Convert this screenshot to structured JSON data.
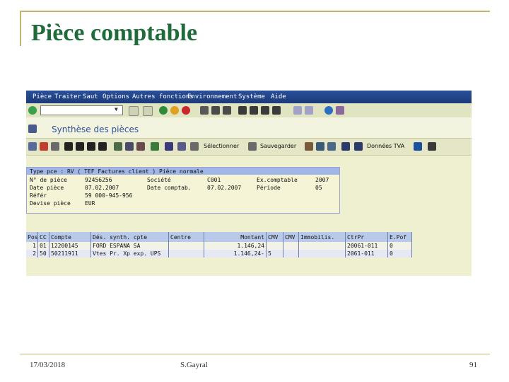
{
  "slide": {
    "title": "Pièce comptable",
    "footer_date": "17/03/2018",
    "footer_author": "S.Gayral",
    "footer_page": "91"
  },
  "menu": [
    {
      "label": "Pièce"
    },
    {
      "label": "Traiter"
    },
    {
      "label": "Saut"
    },
    {
      "label": "Options"
    },
    {
      "label": "Autres fonctions"
    },
    {
      "label": "Environnement"
    },
    {
      "label": "Système"
    },
    {
      "label": "Aide"
    }
  ],
  "screen_title": "Synthèse des pièces",
  "toolbar": {
    "select_label": "Sélectionner",
    "save_label": "Sauvegarder",
    "tva_label": "Données TVA"
  },
  "header": {
    "doc_type_line": "Type pce : RV ( TEF Factures client ) Pièce normale",
    "fields": [
      {
        "label": "N° de pièce",
        "value": "92456256",
        "label2": "Société",
        "value2": "C001",
        "label3": "Ex.comptable",
        "value3": "2007"
      },
      {
        "label": "Date pièce",
        "value": "07.02.2007",
        "label2": "Date comptab.",
        "value2": "07.02.2007",
        "label3": "Période",
        "value3": "05"
      },
      {
        "label": "Référ",
        "value": "59 000-945-956"
      },
      {
        "label": "Devise pièce",
        "value": "EUR"
      }
    ]
  },
  "grid": {
    "columns": [
      "Pos",
      "CC",
      "Compte",
      "Dés. synth. cpte",
      "Centre",
      "Montant",
      "CMV",
      "CMV",
      "Immobilis.",
      "CtrPr",
      "E.Pof"
    ],
    "rows": [
      [
        "1",
        "01",
        "12200145",
        "FORD ESPANA SA",
        "",
        "1.146,24",
        "",
        "",
        "",
        "20061-011",
        "0"
      ],
      [
        "2",
        "50",
        "50211911",
        "Vtes Pr. Xp exp. UPS",
        "",
        "1.146,24-",
        "5",
        "",
        "",
        "2061-011",
        "0"
      ]
    ]
  }
}
